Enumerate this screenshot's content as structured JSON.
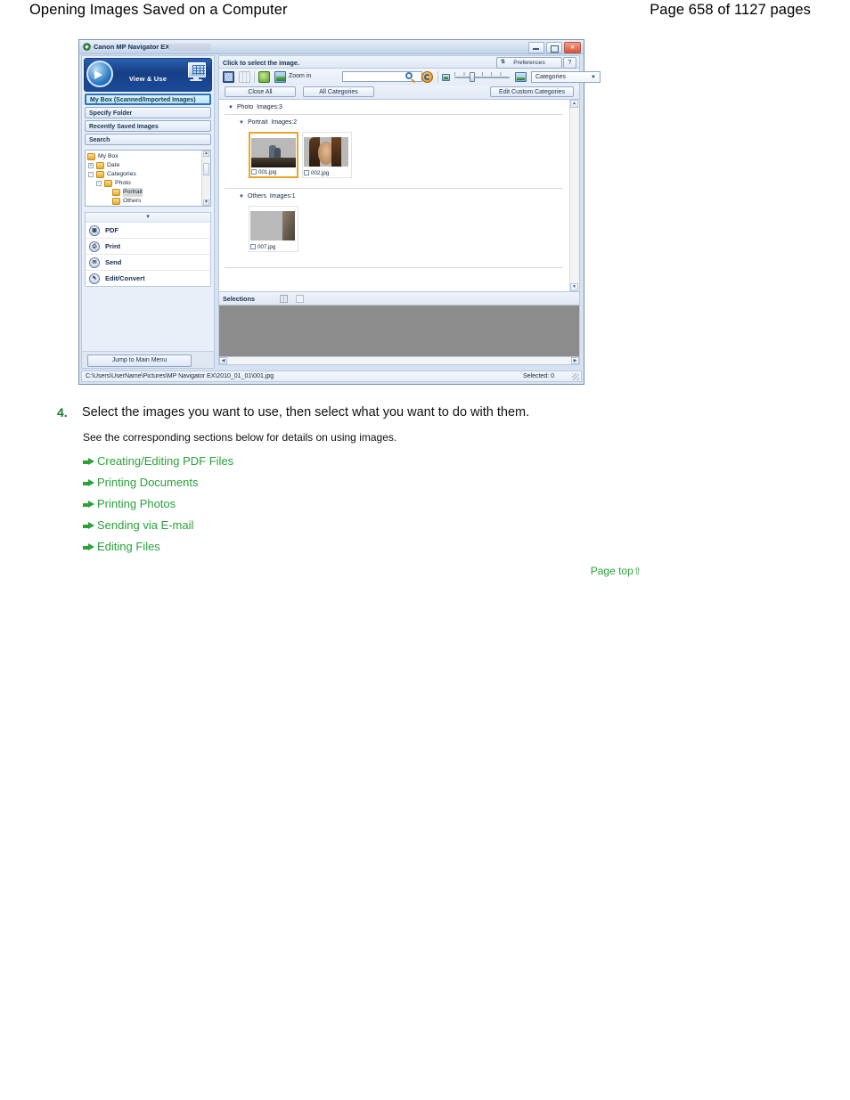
{
  "page": {
    "doc_title": "Opening Images Saved on a Computer",
    "page_number": "Page 658 of 1127 pages"
  },
  "app_window": {
    "title": "Canon MP Navigator EX",
    "title_icon": "canon-app-icon",
    "window_controls": {
      "minimize": "minimize-icon",
      "maximize": "maximize-icon",
      "close": "close-icon"
    },
    "banner": {
      "label": "View & Use",
      "left_icon": "globe-arrow-icon",
      "right_icon": "monitor-grid-icon"
    },
    "nav_buttons": [
      {
        "label": "My Box (Scanned/Imported Images)",
        "active": true
      },
      {
        "label": "Specify Folder",
        "active": false
      },
      {
        "label": "Recently Saved Images",
        "active": false
      },
      {
        "label": "Search",
        "active": false
      }
    ],
    "tree": [
      {
        "label": "My Box",
        "expander": "",
        "indent": 2,
        "selected": false
      },
      {
        "label": "Date",
        "expander": "+",
        "indent": 10,
        "selected": false
      },
      {
        "label": "Categories",
        "expander": "-",
        "indent": 10,
        "selected": false
      },
      {
        "label": "Photo",
        "expander": "-",
        "indent": 19,
        "selected": false
      },
      {
        "label": "Portrait",
        "expander": "",
        "indent": 28,
        "selected": true
      },
      {
        "label": "Others",
        "expander": "",
        "indent": 28,
        "selected": false
      }
    ],
    "actions": {
      "collapse_chevron": "chevron-down-icon",
      "items": [
        {
          "label": "PDF",
          "icon": "pdf-icon",
          "glyph": "⎙"
        },
        {
          "label": "Print",
          "icon": "print-icon",
          "glyph": "⎙"
        },
        {
          "label": "Send",
          "icon": "send-mail-icon",
          "glyph": "✉"
        },
        {
          "label": "Edit/Convert",
          "icon": "edit-convert-icon",
          "glyph": "✎"
        }
      ]
    },
    "jump_button": "Jump to Main Menu",
    "hint_bar": {
      "hint": "Click to select the image.",
      "preferences_label": "Preferences",
      "preferences_icon": "gears-icon",
      "help_label": "?"
    },
    "toolbar": {
      "view_grid_large_icon": "grid-large-icon",
      "view_grid_small_icon": "grid-small-icon",
      "rotate_icon": "rotate-icon",
      "zoom_image_icon": "zoom-image-icon",
      "zoom_label": "Zoom in",
      "search_input_value": "",
      "search_input_placeholder": "",
      "search_icon": "magnifier-icon",
      "refresh_icon": "refresh-icon",
      "small_thumb_icon": "small-thumbnail-icon",
      "large_thumb_icon": "large-thumbnail-icon",
      "size_slider_value": "28",
      "category_select_value": "Categories",
      "category_select_caret": "chevron-down-icon"
    },
    "filter_buttons": {
      "close_all": "Close All",
      "all_categories": "All Categories",
      "edit_custom_categories": "Edit Custom Categories"
    },
    "groups": [
      {
        "name": "Photo",
        "count_label": "Images:3",
        "tri": "▼",
        "level": 0,
        "items": []
      },
      {
        "name": "Portrait",
        "count_label": "Images:2",
        "tri": "▼",
        "level": 1,
        "items": [
          {
            "file": "001.jpg",
            "selected": true,
            "checked": false,
            "pic": "pic-001"
          },
          {
            "file": "002.jpg",
            "selected": false,
            "checked": false,
            "pic": "pic-002"
          }
        ]
      },
      {
        "name": "Others",
        "count_label": "Images:1",
        "tri": "▼",
        "level": 1,
        "items": [
          {
            "file": "007.jpg",
            "selected": false,
            "checked": false,
            "pic": "pic-007"
          }
        ]
      }
    ],
    "selections_bar": {
      "label": "Selections",
      "grid_icon": "selection-grid-icon",
      "blank_icon": "selection-blank-icon"
    },
    "status_bar": {
      "path": "C:\\Users\\UserName\\Pictures\\MP Navigator EX\\2010_01_01\\001.jpg",
      "selected": "Selected: 0",
      "grip": "resize-grip-icon"
    }
  },
  "instruction": {
    "number": "4.",
    "headline": "Select the images you want to use, then select what you want to do with them.",
    "subtext": "See the corresponding sections below for details on using images.",
    "links": [
      "Creating/Editing PDF Files",
      "Printing Documents",
      "Printing Photos",
      "Sending via E-mail",
      "Editing Files"
    ],
    "page_top": "Page top",
    "page_top_arrow": "⇧"
  },
  "colors": {
    "link_green": "#2aa13b",
    "selected_orange": "#e9a52c",
    "banner_blue": "#1b4b9c",
    "gray_pane": "#8c8c8c"
  }
}
